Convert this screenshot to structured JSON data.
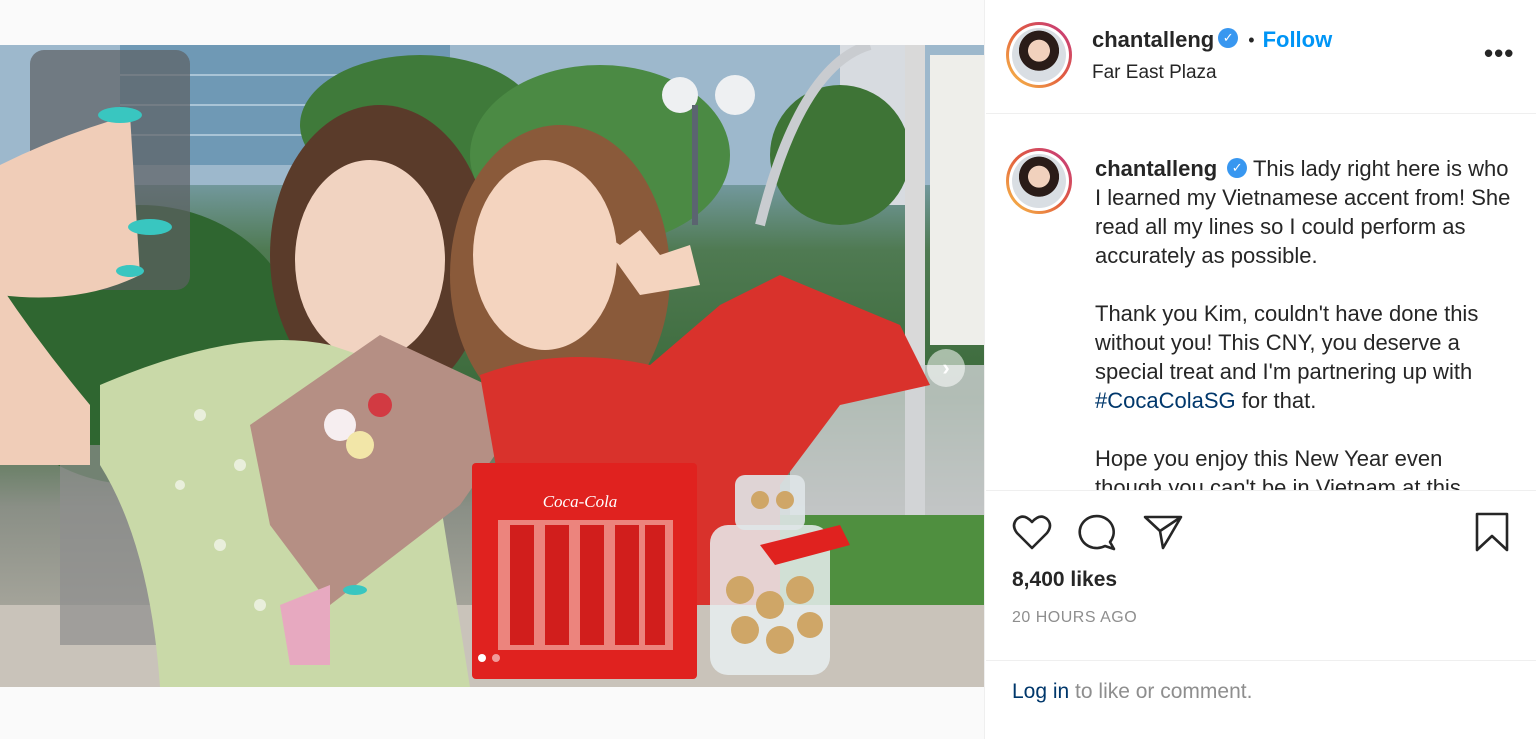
{
  "post": {
    "username": "chantalleng",
    "verified": true,
    "separator": "•",
    "follow_label": "Follow",
    "location": "Far East Plaza",
    "more_icon": "more-horizontal-icon",
    "more_label": "•••",
    "verified_icon": "verified-badge-icon",
    "verified_mark": "✓"
  },
  "caption": {
    "username": "chantalleng",
    "para1": "This lady right here is who I learned my Vietnamese accent from! She read all my lines so I could perform as accurately as possible.",
    "para2_before": "Thank you Kim, couldn't have done this without you! This CNY, you deserve a special treat and I'm partnering up with ",
    "hashtag": "#CocaColaSG",
    "para2_after": " for that.",
    "para3": "Hope you enjoy this New Year even though you can't be in Vietnam at this"
  },
  "actions": {
    "like_icon": "heart-icon",
    "comment_icon": "comment-icon",
    "share_icon": "share-icon",
    "save_icon": "bookmark-icon"
  },
  "stats": {
    "likes": "8,400 likes",
    "timestamp": "20 HOURS AGO"
  },
  "footer": {
    "login_link": "Log in",
    "login_rest": " to like or comment."
  },
  "media": {
    "carousel_next": "›",
    "carousel_next_icon": "chevron-right-icon",
    "slide_count": 2,
    "active_slide": 1,
    "product_brand": "Coca-Cola"
  },
  "colors": {
    "accent": "#0095f6",
    "verified": "#3897f0",
    "hashtag": "#00376b",
    "muted": "#8e8e8e"
  }
}
